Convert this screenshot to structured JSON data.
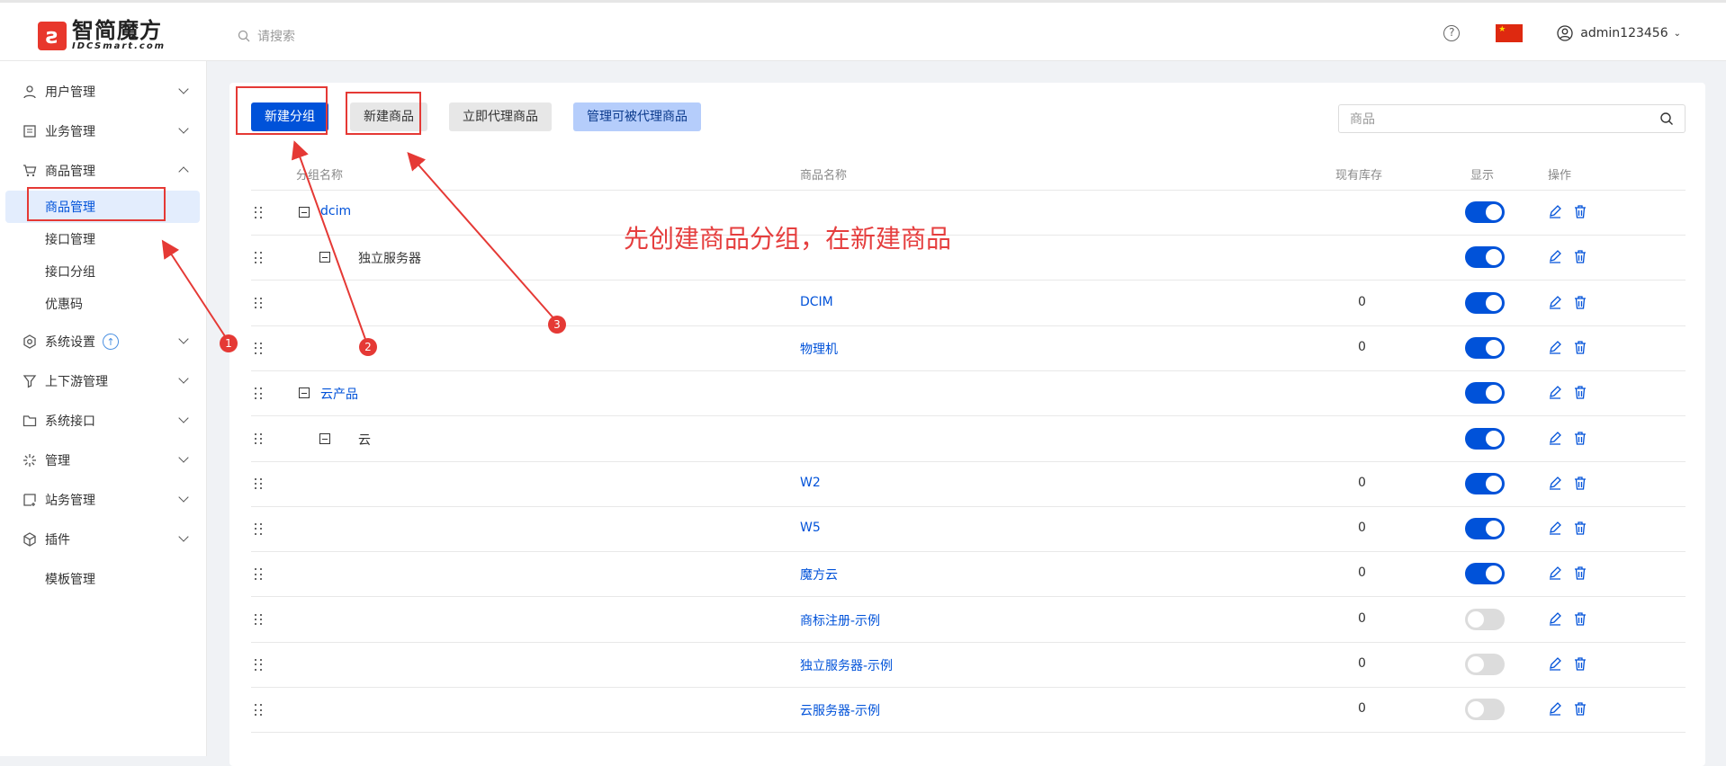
{
  "header": {
    "logo_cn": "智简魔方",
    "logo_en": "IDCSmart.com",
    "search_placeholder": "请搜索",
    "help_symbol": "?",
    "language_flag": "cn-flag",
    "username": "admin123456"
  },
  "sidebar": {
    "items": [
      {
        "label": "用户管理",
        "icon": "user-icon"
      },
      {
        "label": "业务管理",
        "icon": "document-icon"
      },
      {
        "label": "商品管理",
        "icon": "cart-icon"
      },
      {
        "label": "系统设置",
        "icon": "gear-icon"
      },
      {
        "label": "上下游管理",
        "icon": "filter-icon"
      },
      {
        "label": "系统接口",
        "icon": "folder-icon"
      },
      {
        "label": "管理",
        "icon": "sparkle-icon"
      },
      {
        "label": "站务管理",
        "icon": "station-icon"
      },
      {
        "label": "插件",
        "icon": "cube-icon"
      },
      {
        "label": "模板管理",
        "icon": ""
      }
    ],
    "sub_items": [
      "商品管理",
      "接口管理",
      "接口分组",
      "优惠码"
    ],
    "upgrade_badge": "↑"
  },
  "toolbar": {
    "new_group": "新建分组",
    "new_product": "新建商品",
    "proxy_product": "立即代理商品",
    "manage_proxy": "管理可被代理商品",
    "search_placeholder": "商品"
  },
  "table": {
    "headers": {
      "group": "分组名称",
      "product": "商品名称",
      "stock": "现有库存",
      "display": "显示",
      "actions": "操作"
    },
    "rows": [
      {
        "group": "dcim",
        "level": 1,
        "product": "",
        "stock": "",
        "display": true
      },
      {
        "group": "独立服务器",
        "level": 2,
        "product": "",
        "stock": "",
        "display": true
      },
      {
        "group": "",
        "level": 3,
        "product": "DCIM",
        "stock": "0",
        "display": true
      },
      {
        "group": "",
        "level": 3,
        "product": "物理机",
        "stock": "0",
        "display": true
      },
      {
        "group": "云产品",
        "level": 1,
        "product": "",
        "stock": "",
        "display": true
      },
      {
        "group": "云",
        "level": 2,
        "product": "",
        "stock": "",
        "display": true
      },
      {
        "group": "",
        "level": 3,
        "product": "W2",
        "stock": "0",
        "display": true
      },
      {
        "group": "",
        "level": 3,
        "product": "W5",
        "stock": "0",
        "display": true
      },
      {
        "group": "",
        "level": 3,
        "product": "魔方云",
        "stock": "0",
        "display": true
      },
      {
        "group": "",
        "level": 3,
        "product": "商标注册-示例",
        "stock": "0",
        "display": false
      },
      {
        "group": "",
        "level": 3,
        "product": "独立服务器-示例",
        "stock": "0",
        "display": false
      },
      {
        "group": "",
        "level": 3,
        "product": "云服务器-示例",
        "stock": "0",
        "display": false
      }
    ]
  },
  "annotation": {
    "text": "先创建商品分组，在新建商品",
    "markers": [
      "1",
      "2",
      "3"
    ],
    "color": "#e53935"
  }
}
